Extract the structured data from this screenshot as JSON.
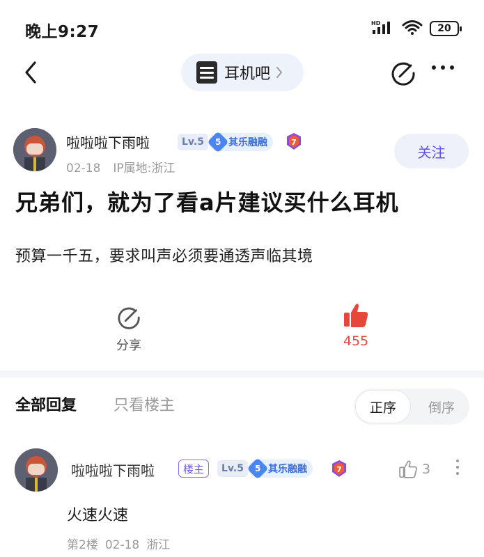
{
  "status_bar": {
    "time": "晚上9:27",
    "network": "HD",
    "battery": "20"
  },
  "nav": {
    "forum_name": "耳机吧"
  },
  "post": {
    "author": {
      "name": "啦啦啦下雨啦",
      "level": "Lv.5",
      "member_level": "5",
      "member_name": "其乐融融",
      "medal": "7"
    },
    "date": "02-18",
    "ip_location": "IP属地:浙江",
    "follow_label": "关注",
    "title": "兄弟们，就为了看a片建议买什么耳机",
    "body": "预算一千五，要求叫声必须要通透声临其境",
    "share_label": "分享",
    "like_count": "455"
  },
  "replies_header": {
    "tab_all": "全部回复",
    "tab_op_only": "只看楼主",
    "sort_asc": "正序",
    "sort_desc": "倒序"
  },
  "replies": [
    {
      "name": "啦啦啦下雨啦",
      "op_badge": "楼主",
      "level": "Lv.5",
      "member_level": "5",
      "member_name": "其乐融融",
      "medal": "7",
      "like_count": "3",
      "text": "火速火速",
      "floor": "第2楼",
      "date": "02-18",
      "location": "浙江"
    }
  ],
  "colors": {
    "accent_purple": "#6152e8",
    "like_red": "#e5473b",
    "member_blue": "#4a86f0"
  }
}
